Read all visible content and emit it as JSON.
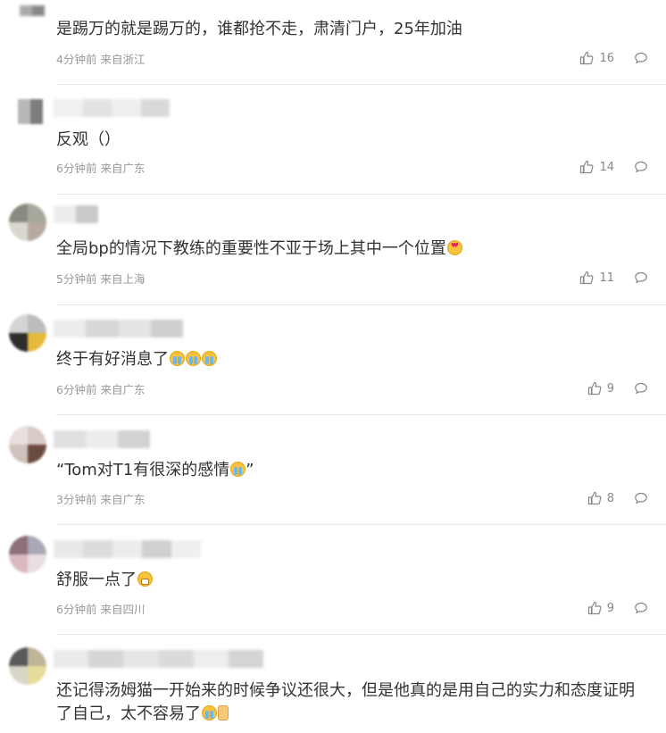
{
  "comments": [
    {
      "text": "是踢万的就是踢万的，谁都抢不走，肃清门户，25年加油",
      "emojis": [],
      "time": "4分钟前",
      "location": "来自浙江",
      "likes": "16"
    },
    {
      "text": "反观（）",
      "emojis": [],
      "time": "6分钟前",
      "location": "来自广东",
      "likes": "14"
    },
    {
      "text": "全局bp的情况下教练的重要性不亚于场上其中一个位置",
      "emojis": [
        "love-face"
      ],
      "time": "5分钟前",
      "location": "来自上海",
      "likes": "11"
    },
    {
      "text": "终于有好消息了",
      "emojis": [
        "crying-face",
        "crying-face",
        "crying-face"
      ],
      "time": "6分钟前",
      "location": "来自广东",
      "likes": "9"
    },
    {
      "text": "“Tom对T1有很深的感情",
      "text_suffix": "”",
      "emojis": [
        "crying-face"
      ],
      "time": "3分钟前",
      "location": "来自广东",
      "likes": "8"
    },
    {
      "text": "舒服一点了",
      "emojis": [
        "grin-face"
      ],
      "time": "6分钟前",
      "location": "来自四川",
      "likes": "9"
    },
    {
      "text": "还记得汤姆猫一开始来的时候争议还很大，但是他真的是用自己的实力和态度证明了自己，太不容易了",
      "emojis": [
        "crying-face",
        "thumbs-up"
      ],
      "time": "",
      "location": "",
      "likes": ""
    }
  ],
  "icons": {
    "like": "thumbs-up-icon",
    "reply": "comment-bubble-icon"
  },
  "colors": {
    "meta_text": "#999999",
    "body_text": "#333333",
    "divider": "#e6e6e6"
  }
}
